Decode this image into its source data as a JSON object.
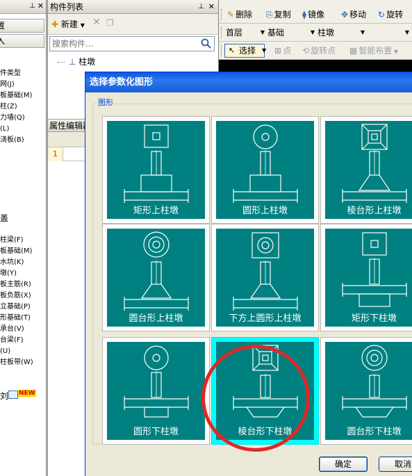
{
  "left_panel": {
    "btn1": "置",
    "btn2": "入",
    "items": [
      "件类型",
      "网(J)",
      "板基础(M)",
      "柱(Z)",
      "力墙(Q)",
      "(L)",
      "浇板(B)"
    ],
    "section2": "盖",
    "items2": [
      "柱梁(F)",
      "板基础(M)",
      "水坑(K)",
      "墩(Y)",
      "板主筋(R)",
      "板负筋(X)",
      "立基础(P)",
      "形基础(T)",
      "承台(V)",
      "台梁(F)",
      "(U)",
      "柱板带(W)"
    ],
    "bottom_text": "刘",
    "new_badge": "NEW"
  },
  "component_panel": {
    "title": "构件列表",
    "new_label": "新建",
    "search_placeholder": "搜索构件...",
    "tree_item": "柱墩",
    "prop_title": "属性编辑器",
    "row_number": "1"
  },
  "main_toolbar": {
    "row1": [
      "删除",
      "复制",
      "镜像",
      "移动",
      "旋转"
    ],
    "combos": [
      "首层",
      "基础",
      "柱墩"
    ],
    "select_label": "选择",
    "row3": [
      "点",
      "旋转点",
      "智能布置"
    ]
  },
  "dialog": {
    "title": "选择参数化图形",
    "group_label": "图形",
    "shapes": [
      {
        "label": "矩形上柱墩"
      },
      {
        "label": "圆形上柱墩"
      },
      {
        "label": "棱台形上柱墩"
      },
      {
        "label": "圆台形上柱墩"
      },
      {
        "label": "下方上圆形上柱墩"
      },
      {
        "label": "矩形下柱墩"
      },
      {
        "label": "圆形下柱墩"
      },
      {
        "label": "棱台形下柱墩"
      },
      {
        "label": "圆台形下柱墩"
      }
    ],
    "selected_index": 7,
    "ok": "确定",
    "cancel": "取消"
  },
  "colors": {
    "tile": "#008080",
    "selection": "#00ffff",
    "annotation": "#e02828",
    "title_bar": "#0a5ae0"
  }
}
